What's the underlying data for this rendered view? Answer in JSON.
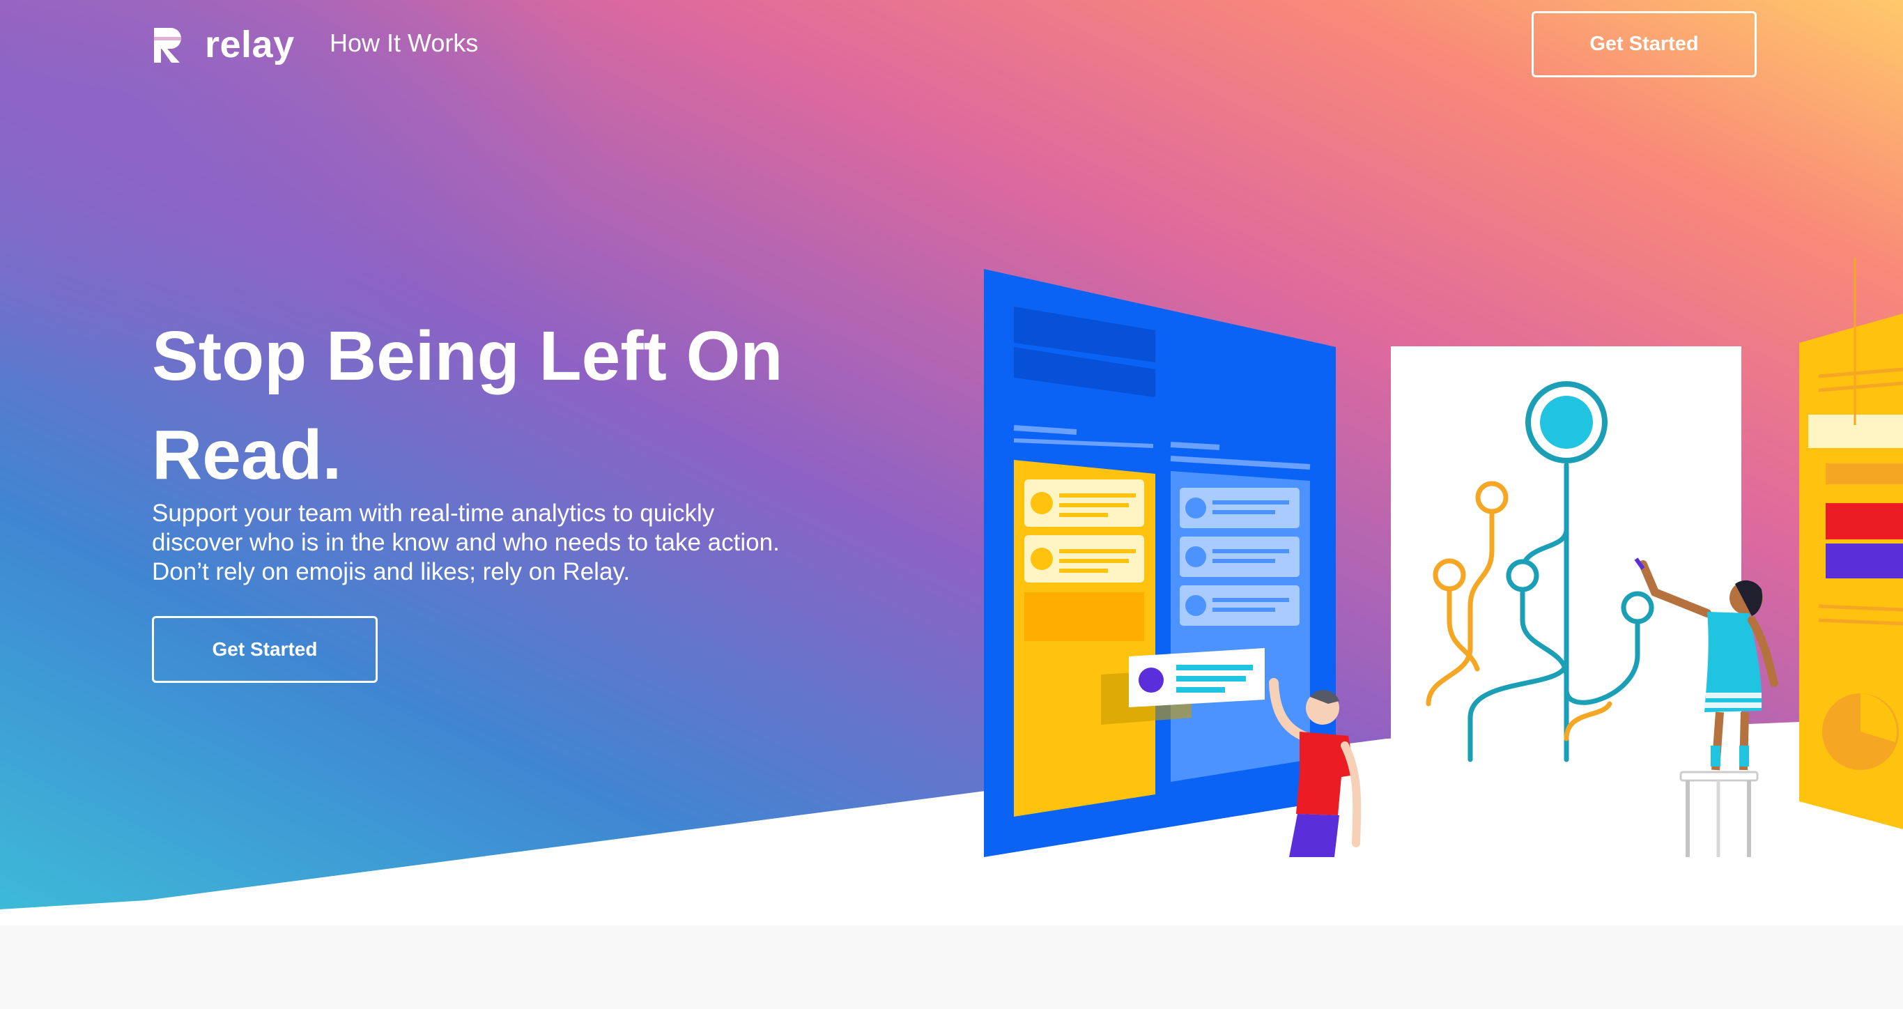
{
  "brand": {
    "name": "relay",
    "logo_icon": "relay-logo-icon"
  },
  "nav": {
    "link_how_it_works": "How It Works",
    "cta_label": "Get Started"
  },
  "hero": {
    "headline": "Stop Being Left On Read.",
    "subtext_lines": [
      "Support your team with real-time analytics to quickly",
      "discover who is in the know and who needs to take action.",
      "Don’t rely on emojis and likes; rely on Relay."
    ],
    "cta_label": "Get Started"
  },
  "colors": {
    "gradient_purple": "#8e62c4",
    "gradient_pink": "#f0708e",
    "gradient_orange": "#ffbd6a",
    "gradient_blue": "#3f86d2",
    "gradient_teal": "#3dbad8",
    "board_blue": "#0b63f5",
    "card_yellow": "#ffc20e",
    "accent_cyan": "#21c4e0",
    "accent_orange": "#f5a623",
    "shirt_red": "#ec1c24",
    "purple": "#5a2ed8"
  },
  "illustration": {
    "name": "team-analytics-board-illustration"
  }
}
